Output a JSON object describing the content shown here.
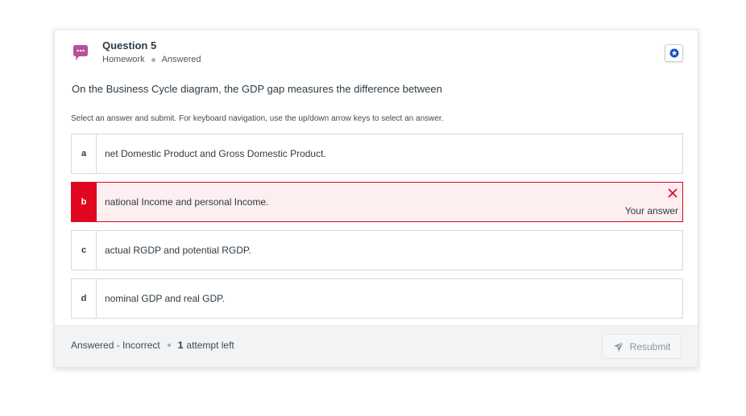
{
  "question": {
    "title": "Question 5",
    "type": "Homework",
    "state": "Answered",
    "text": "On the Business Cycle diagram, the GDP gap measures the difference between",
    "instructions": "Select an answer and submit. For keyboard navigation, use the up/down arrow keys to select an answer."
  },
  "options": [
    {
      "letter": "a",
      "text": "net Domestic Product and Gross Domestic Product."
    },
    {
      "letter": "b",
      "text": "national Income and personal Income.",
      "selected": true,
      "incorrect": true,
      "your_answer_label": "Your answer"
    },
    {
      "letter": "c",
      "text": "actual RGDP and potential RGDP."
    },
    {
      "letter": "d",
      "text": "nominal GDP and real GDP."
    }
  ],
  "footer": {
    "status": "Answered - Incorrect",
    "attempts_count": "1",
    "attempts_label": "attempt left",
    "resubmit_label": "Resubmit"
  },
  "icons": {
    "question_icon": "chat-bubble-icon",
    "flag_icon": "star-flag-icon",
    "incorrect_icon": "x-icon",
    "submit_icon": "paper-plane-icon"
  },
  "colors": {
    "accent_purple": "#b5509b",
    "error_red": "#e0061f",
    "flag_blue": "#1d4fc4"
  }
}
